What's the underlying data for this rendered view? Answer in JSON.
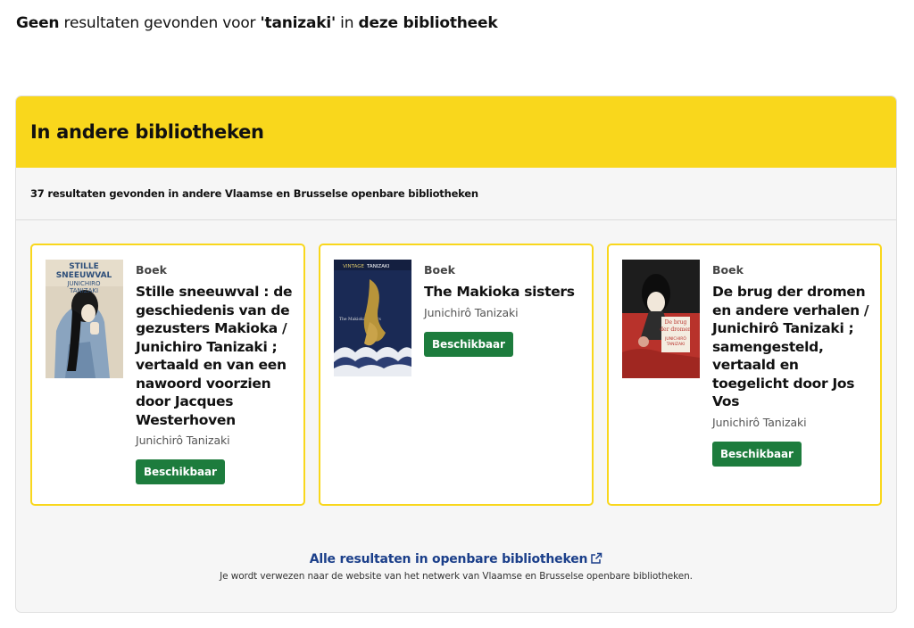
{
  "no_results": {
    "strong1": "Geen",
    "text1": " resultaten gevonden voor ",
    "query": "'tanizaki'",
    "text2": " in ",
    "strong2": "deze bibliotheek"
  },
  "panel": {
    "title": "In andere bibliotheken",
    "count_text": "37 resultaten gevonden in andere Vlaamse en Brusselse openbare bibliotheken"
  },
  "cards": [
    {
      "kind": "Boek",
      "title": "Stille sneeuwval : de geschiedenis van de gezusters Makioka / Junichiro Tanizaki ; vertaald en van een nawoord voorzien door Jacques Westerhoven",
      "author": "Junichirô Tanizaki",
      "status": "Beschikbaar",
      "cover_text": [
        "STILLE",
        "SNEEUWVAL",
        "JUNICHIRO",
        "TANIZAKI"
      ]
    },
    {
      "kind": "Boek",
      "title": "The Makioka sisters",
      "author": "Junichirô Tanizaki",
      "status": "Beschikbaar",
      "cover_text": [
        "VINTAGE",
        "TANIZAKI",
        "The Makioka Sisters"
      ]
    },
    {
      "kind": "Boek",
      "title": "De brug der dromen en andere verhalen / Junichirô Tanizaki ; samengesteld, vertaald en toegelicht door Jos Vos",
      "author": "Junichirô Tanizaki",
      "status": "Beschikbaar",
      "cover_text": [
        "De brug",
        "der dromen",
        "JUNICHIRÔ",
        "TANIZAKI"
      ]
    }
  ],
  "footer": {
    "link": "Alle resultaten in openbare bibliotheken",
    "note": "Je wordt verwezen naar de website van het netwerk van Vlaamse en Brusselse openbare bibliotheken."
  },
  "colors": {
    "accent_yellow": "#f9d71c",
    "available_green": "#1d7c3d",
    "link_blue": "#1b3f8a"
  }
}
